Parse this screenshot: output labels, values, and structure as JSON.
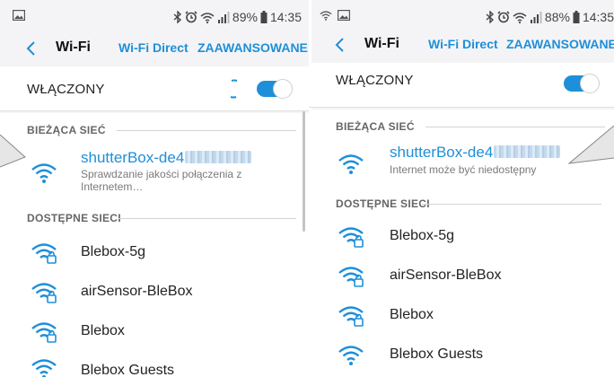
{
  "left": {
    "status": {
      "battery": "89%",
      "time": "14:35"
    },
    "appbar": {
      "title": "Wi-Fi",
      "tab_direct": "Wi-Fi Direct",
      "tab_advanced": "ZAAWANSOWANE"
    },
    "toggle": {
      "label": "WŁĄCZONY",
      "on": true,
      "connecting": true
    },
    "current_header": "BIEŻĄCA SIEĆ",
    "current": {
      "name": "shutterBox-de4",
      "status": "Sprawdzanie jakości połączenia z Internetem…"
    },
    "available_header": "DOSTĘPNE SIECI",
    "networks": [
      {
        "name": "Blebox-5g",
        "secured": true
      },
      {
        "name": "airSensor-BleBox",
        "secured": true
      },
      {
        "name": "Blebox",
        "secured": true
      },
      {
        "name": "Blebox Guests",
        "secured": false
      }
    ]
  },
  "right": {
    "status": {
      "battery": "88%",
      "time": "14:35"
    },
    "appbar": {
      "title": "Wi-Fi",
      "tab_direct": "Wi-Fi Direct",
      "tab_advanced": "ZAAWANSOWANE"
    },
    "toggle": {
      "label": "WŁĄCZONY",
      "on": true
    },
    "current_header": "BIEŻĄCA SIEĆ",
    "current": {
      "name": "shutterBox-de4",
      "status": "Internet może być niedostępny"
    },
    "available_header": "DOSTĘPNE SIECI",
    "networks": [
      {
        "name": "Blebox-5g",
        "secured": true
      },
      {
        "name": "airSensor-BleBox",
        "secured": true
      },
      {
        "name": "Blebox",
        "secured": true
      },
      {
        "name": "Blebox Guests",
        "secured": false
      }
    ]
  },
  "colors": {
    "accent": "#1e8fd9",
    "text": "#222222",
    "subtext": "#7a7a7a"
  },
  "icons": [
    "image-icon",
    "bluetooth-icon",
    "alarm-icon",
    "wifi-status-icon",
    "signal-icon",
    "battery-icon",
    "back-arrow-icon",
    "wifi-icon",
    "wifi-locked-icon"
  ]
}
